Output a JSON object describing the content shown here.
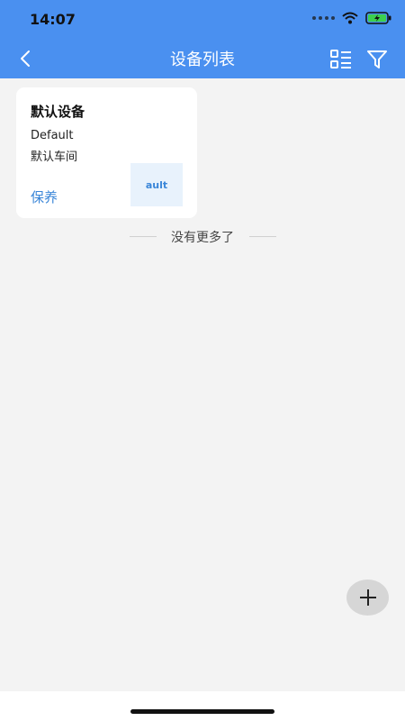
{
  "status_bar": {
    "time": "14:07"
  },
  "nav": {
    "title": "设备列表"
  },
  "device_card": {
    "name": "默认设备",
    "code": "Default",
    "location": "默认车间",
    "action_label": "保养",
    "thumbnail_text": "ault"
  },
  "list_end_text": "没有更多了",
  "colors": {
    "header": "#4a90f0",
    "accent": "#3a86d8",
    "background": "#f3f3f3"
  },
  "icons": [
    "back-arrow-icon",
    "list-view-icon",
    "filter-icon",
    "add-icon",
    "wifi-icon",
    "battery-icon"
  ]
}
